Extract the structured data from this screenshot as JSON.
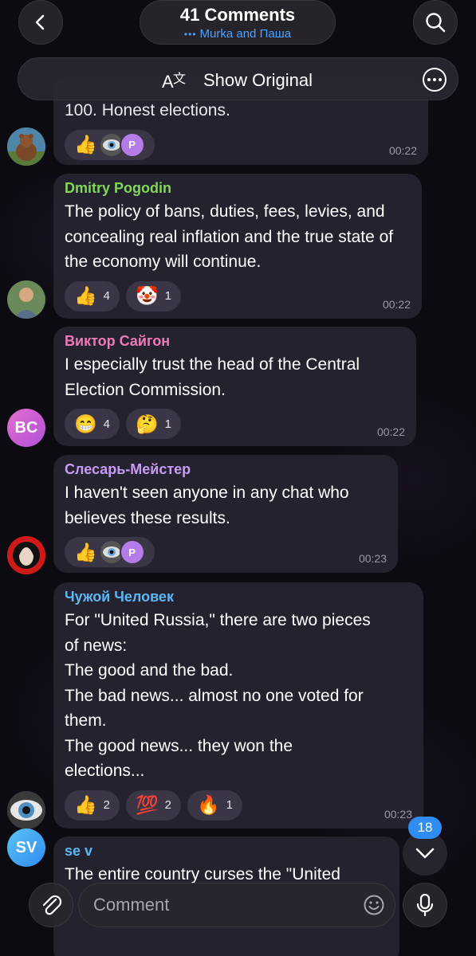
{
  "header": {
    "title": "41 Comments",
    "subtitle": "Murka and Паша"
  },
  "translate_bar": {
    "label": "Show Original"
  },
  "messages": [
    {
      "author": "",
      "text": "100. Honest elections.",
      "reactions": [
        {
          "emoji": "👍",
          "count": ""
        }
      ],
      "avatar_initial": "P",
      "time": "00:22"
    },
    {
      "author": "Dmitry Pogodin",
      "author_color": "#7ed957",
      "text": "The policy of bans, duties, fees, levies, and concealing real inflation and the true state of the economy will continue.",
      "reactions": [
        {
          "emoji": "👍",
          "count": "4"
        },
        {
          "emoji": "🤡",
          "count": "1"
        }
      ],
      "time": "00:22"
    },
    {
      "author": "Виктор Сайгон",
      "author_color": "#f07ab8",
      "text": "I especially trust the head of the Central Election Commission.",
      "reactions": [
        {
          "emoji": "😁",
          "count": "4"
        },
        {
          "emoji": "🤔",
          "count": "1"
        }
      ],
      "avatar": "BC",
      "time": "00:22"
    },
    {
      "author": "Слесарь-Мейстер",
      "author_color": "#c89cf5",
      "text": "I haven't seen anyone in any chat who believes these results.",
      "reactions": [
        {
          "emoji": "👍",
          "count": ""
        }
      ],
      "avatar_initial": "P",
      "time": "00:23"
    },
    {
      "author": "Чужой Человек",
      "author_color": "#5ab8f5",
      "lines": [
        "For \"United Russia,\" there are two pieces",
        "of news:",
        "The good and the bad.",
        "The bad news... almost no one voted for",
        "them.",
        "The good news... they won the",
        "elections..."
      ],
      "reactions": [
        {
          "emoji": "👍",
          "count": "2"
        },
        {
          "emoji": "💯",
          "count": "2"
        },
        {
          "emoji": "🔥",
          "count": "1"
        }
      ],
      "time": "00:23"
    },
    {
      "author": "se v",
      "author_color": "#5ab8f5",
      "text": "The entire country curses the \"United",
      "avatar": "SV"
    }
  ],
  "unread_count": "18",
  "composer": {
    "placeholder": "Comment"
  },
  "colors": {
    "accent": "#2f8cf0",
    "bubble": "#252230"
  }
}
